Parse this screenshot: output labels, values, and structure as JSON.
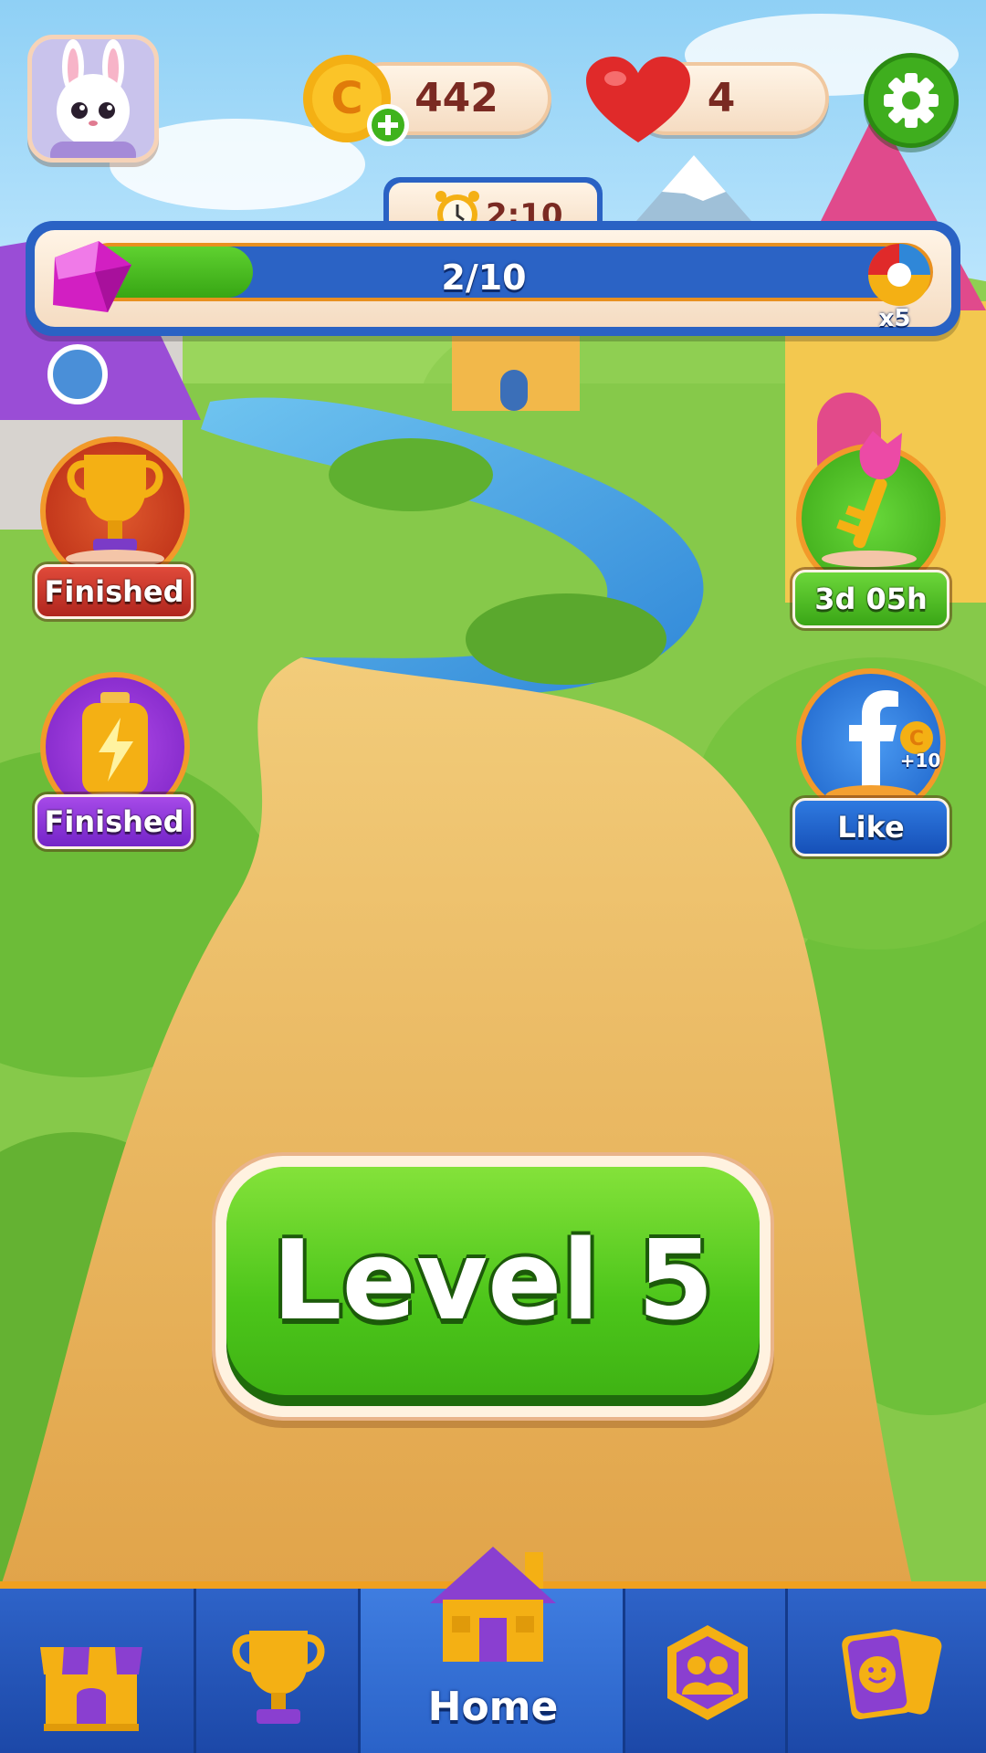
{
  "hud": {
    "coins": "442",
    "lives": "4",
    "timer": "2:10",
    "progress_label": "2/10",
    "progress_value": 0.2,
    "multiplier": "x5"
  },
  "left_events": [
    {
      "label": "Finished",
      "icon": "trophy-icon"
    },
    {
      "label": "Finished",
      "icon": "battery-icon"
    }
  ],
  "right_events": [
    {
      "label": "3d 05h",
      "icon": "key-icon"
    },
    {
      "label": "Like",
      "icon": "facebook-icon",
      "reward": "+10"
    }
  ],
  "play_button": {
    "label": "Level 5"
  },
  "nav": {
    "items": [
      {
        "icon": "shop-icon"
      },
      {
        "icon": "trophy-icon"
      },
      {
        "icon": "home-icon",
        "label": "Home"
      },
      {
        "icon": "team-icon"
      },
      {
        "icon": "cards-icon"
      }
    ]
  },
  "colors": {
    "accent_green": "#4cc51a",
    "nav_blue": "#2e63c8",
    "coin_gold": "#f5a510",
    "heart_red": "#e02a2a"
  }
}
